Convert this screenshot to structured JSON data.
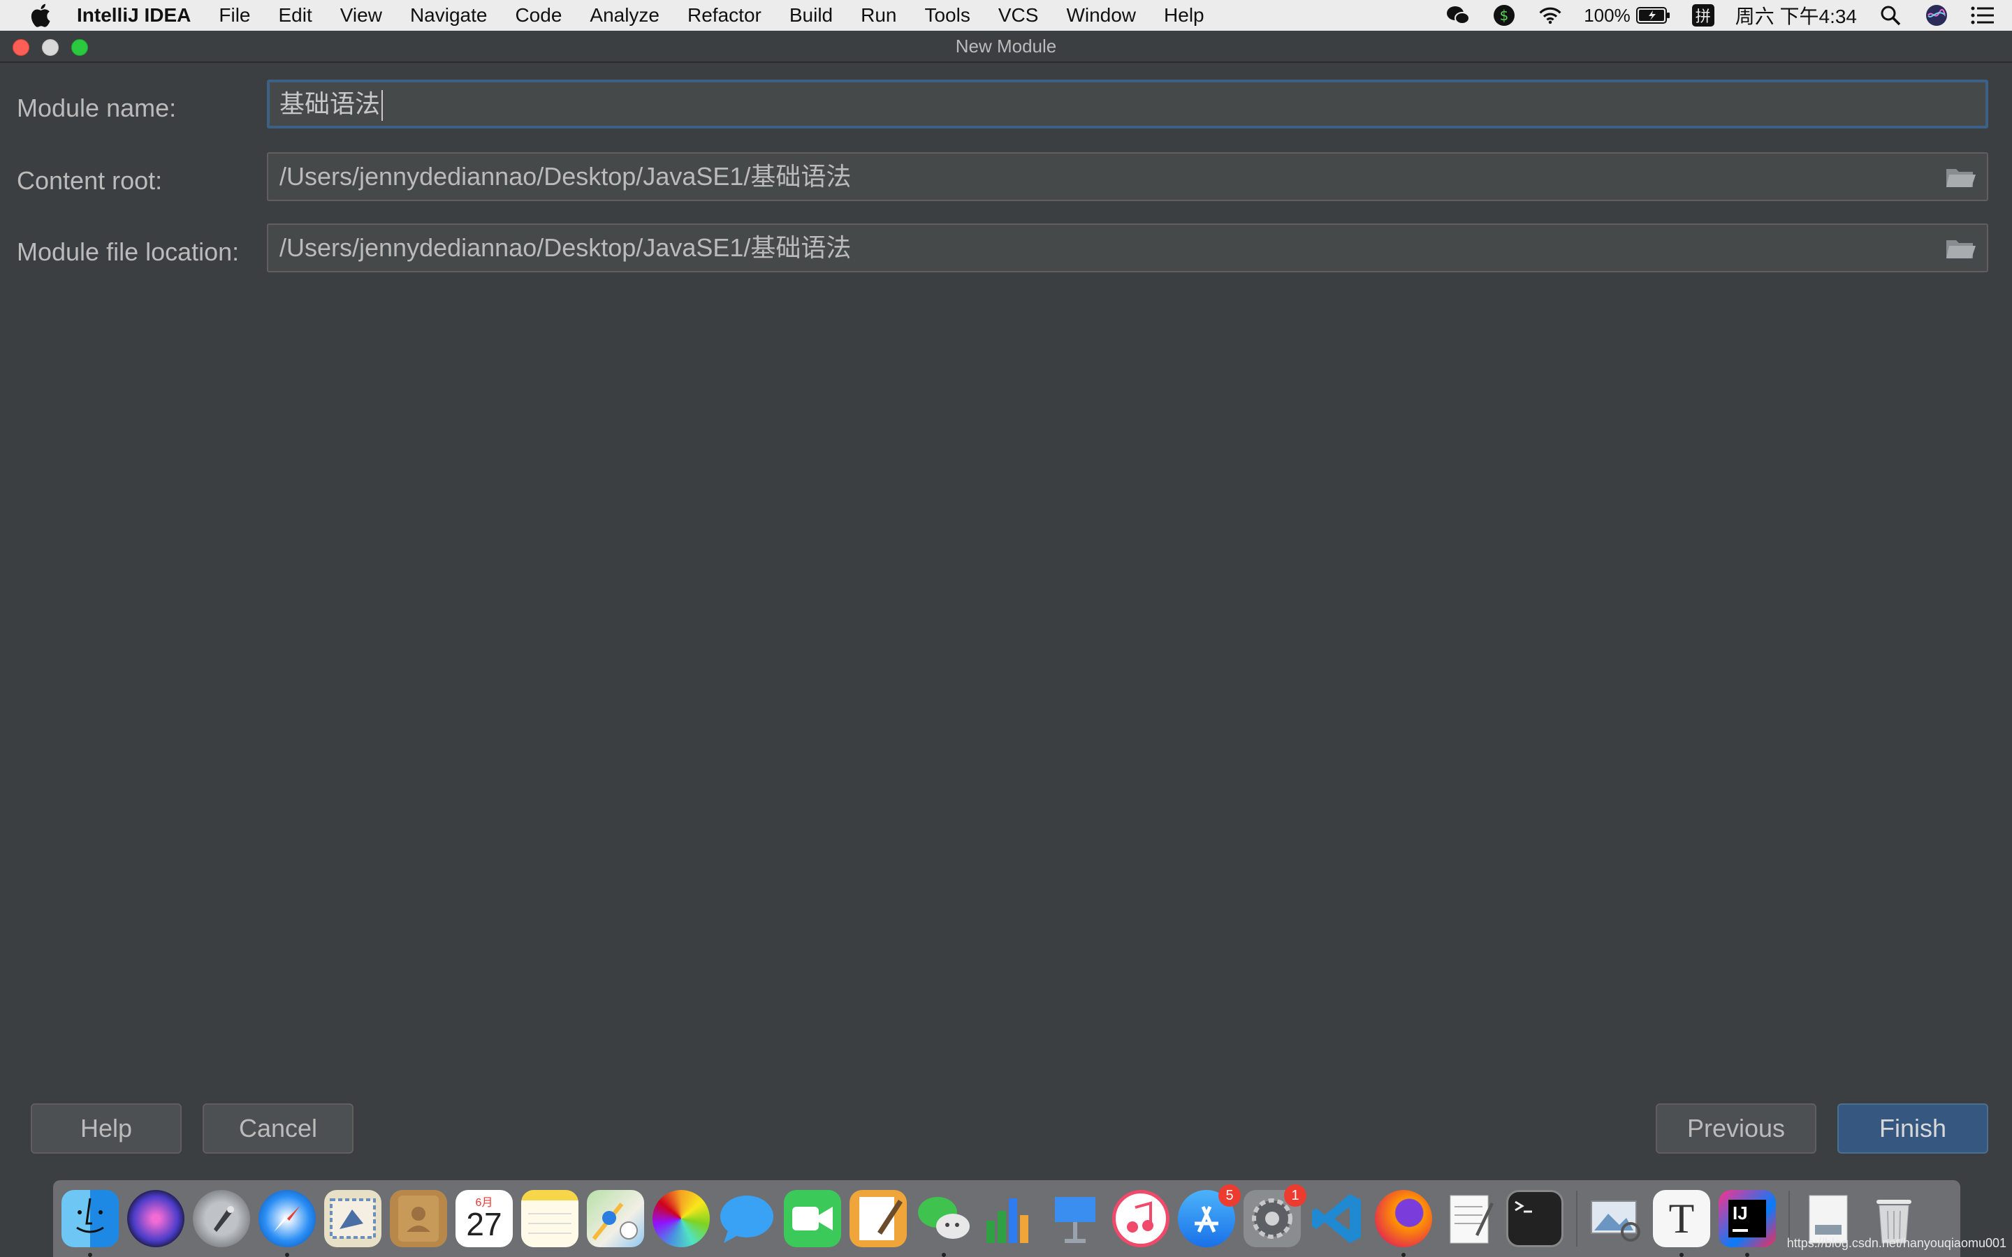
{
  "menubar": {
    "app_name": "IntelliJ IDEA",
    "items": [
      "File",
      "Edit",
      "View",
      "Navigate",
      "Code",
      "Analyze",
      "Refactor",
      "Build",
      "Run",
      "Tools",
      "VCS",
      "Window",
      "Help"
    ],
    "status": {
      "battery": "100%",
      "input_method": "拼",
      "clock": "周六 下午4:34"
    }
  },
  "window": {
    "title": "New Module"
  },
  "form": {
    "module_name_label": "Module name:",
    "module_name_value": "基础语法",
    "content_root_label": "Content root:",
    "content_root_value": "/Users/jennydediannao/Desktop/JavaSE1/基础语法",
    "module_file_label": "Module file location:",
    "module_file_value": "/Users/jennydediannao/Desktop/JavaSE1/基础语法"
  },
  "buttons": {
    "help": "Help",
    "cancel": "Cancel",
    "previous": "Previous",
    "finish": "Finish"
  },
  "dock": {
    "calendar_month": "6月",
    "calendar_day": "27",
    "appstore_badge": "5",
    "settings_badge": "1",
    "textedit_letter": "T",
    "intellij_letters": "IJ"
  },
  "watermark": "https://blog.csdn.net/hanyouqiaomu001",
  "colors": {
    "background": "#3c3f41",
    "field": "#45494a",
    "focus_border": "#3d6185",
    "primary_button": "#365880"
  }
}
